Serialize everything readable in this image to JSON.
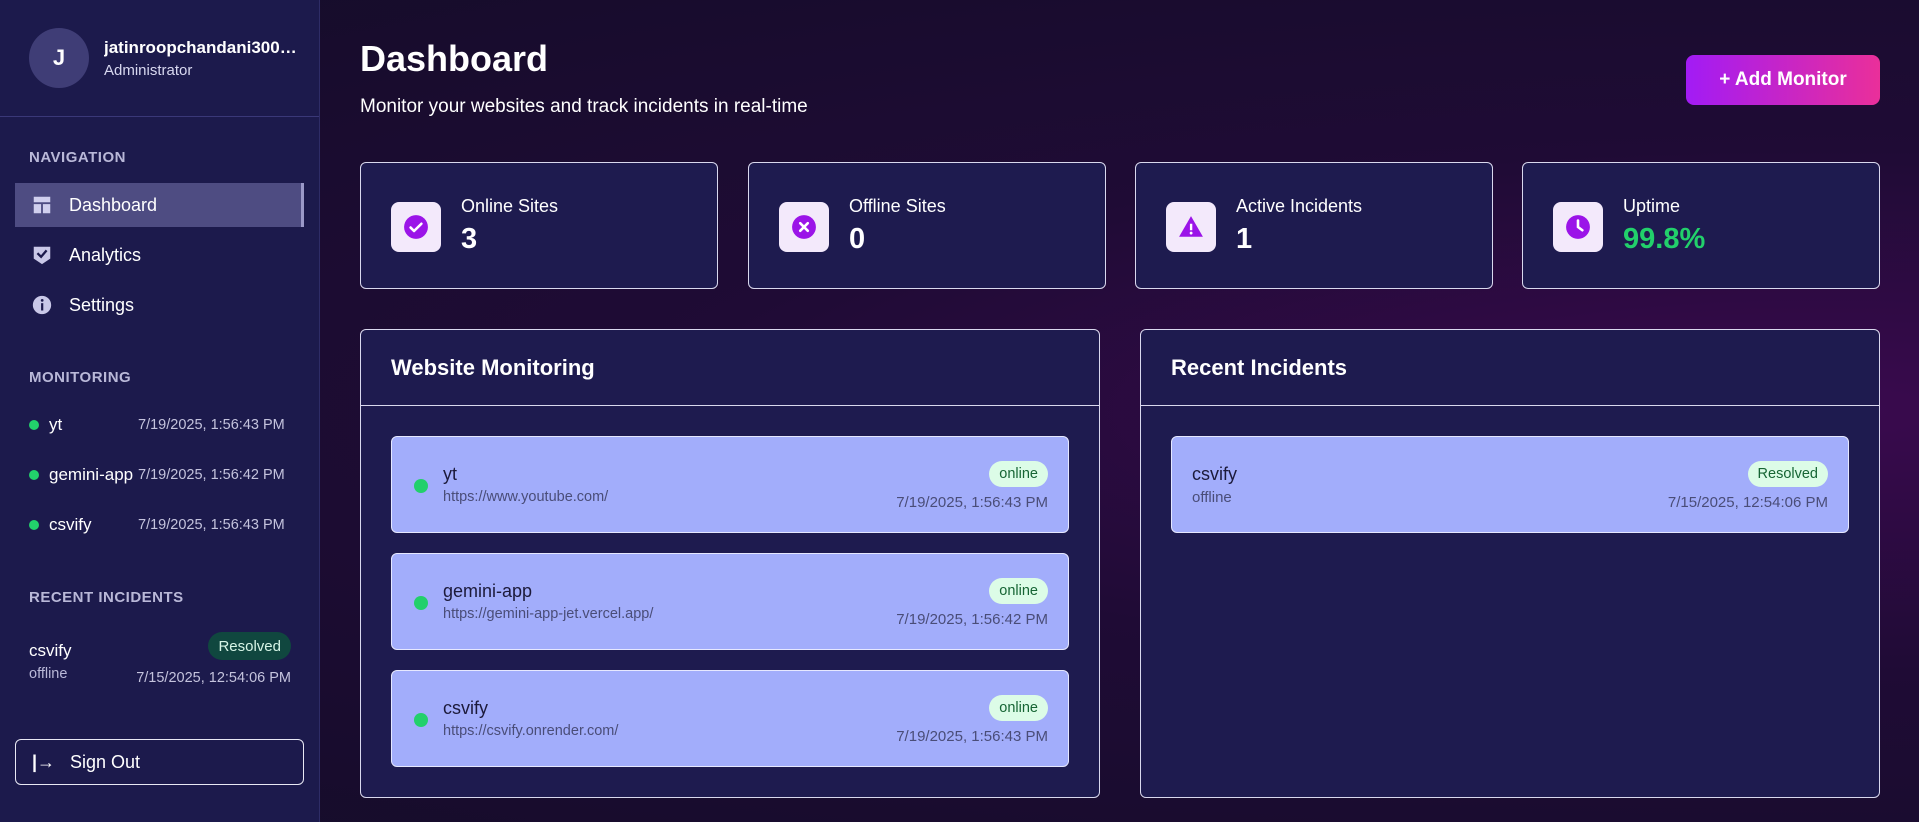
{
  "sidebar": {
    "profile": {
      "initial": "J",
      "name": "jatinroopchandani300…",
      "role": "Administrator"
    },
    "nav_title": "NAVIGATION",
    "nav": [
      {
        "label": "Dashboard",
        "icon": "dashboard-icon",
        "active": true
      },
      {
        "label": "Analytics",
        "icon": "analytics-icon",
        "active": false
      },
      {
        "label": "Settings",
        "icon": "info-icon",
        "active": false
      }
    ],
    "monitoring_title": "MONITORING",
    "monitoring": [
      {
        "name": "yt",
        "time": "7/19/2025, 1:56:43 PM",
        "status_color": "#22d06b"
      },
      {
        "name": "gemini-app",
        "time": "7/19/2025, 1:56:42 PM",
        "status_color": "#22d06b"
      },
      {
        "name": "csvify",
        "time": "7/19/2025, 1:56:43 PM",
        "status_color": "#22d06b"
      }
    ],
    "incidents_title": "RECENT INCIDENTS",
    "incident": {
      "name": "csvify",
      "status": "offline",
      "badge": "Resolved",
      "time": "7/15/2025, 12:54:06 PM"
    },
    "signout_label": "Sign Out"
  },
  "header": {
    "title": "Dashboard",
    "subtitle": "Monitor your websites and track incidents in real-time",
    "add_button": "+ Add Monitor"
  },
  "stats": [
    {
      "label": "Online Sites",
      "value": "3",
      "icon": "check-circle-icon"
    },
    {
      "label": "Offline Sites",
      "value": "0",
      "icon": "x-circle-icon"
    },
    {
      "label": "Active Incidents",
      "value": "1",
      "icon": "warning-icon"
    },
    {
      "label": "Uptime",
      "value": "99.8%",
      "icon": "clock-icon"
    }
  ],
  "website_monitoring": {
    "title": "Website Monitoring",
    "sites": [
      {
        "name": "yt",
        "url": "https://www.youtube.com/",
        "status": "online",
        "time": "7/19/2025, 1:56:43 PM"
      },
      {
        "name": "gemini-app",
        "url": "https://gemini-app-jet.vercel.app/",
        "status": "online",
        "time": "7/19/2025, 1:56:42 PM"
      },
      {
        "name": "csvify",
        "url": "https://csvify.onrender.com/",
        "status": "online",
        "time": "7/19/2025, 1:56:43 PM"
      }
    ]
  },
  "recent_incidents": {
    "title": "Recent Incidents",
    "items": [
      {
        "name": "csvify",
        "status": "offline",
        "badge": "Resolved",
        "time": "7/15/2025, 12:54:06 PM"
      }
    ]
  },
  "colors": {
    "accent": "#a21bf5",
    "accent_end": "#ea2f9a",
    "online": "#22d06b"
  }
}
